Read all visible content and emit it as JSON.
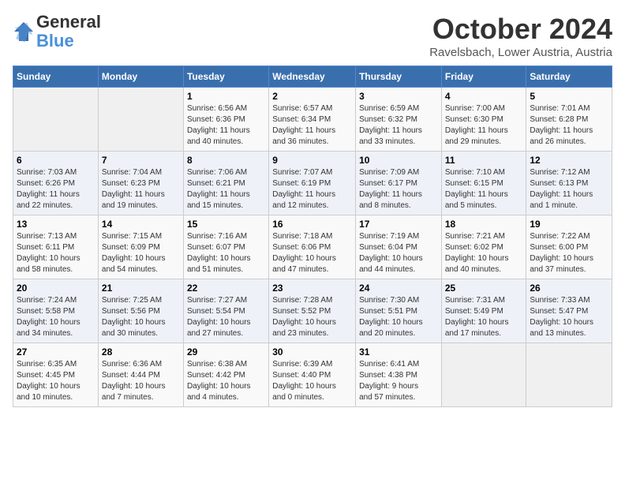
{
  "header": {
    "logo_line1": "General",
    "logo_line2": "Blue",
    "month": "October 2024",
    "location": "Ravelsbach, Lower Austria, Austria"
  },
  "weekdays": [
    "Sunday",
    "Monday",
    "Tuesday",
    "Wednesday",
    "Thursday",
    "Friday",
    "Saturday"
  ],
  "weeks": [
    [
      {
        "day": "",
        "info": ""
      },
      {
        "day": "",
        "info": ""
      },
      {
        "day": "1",
        "info": "Sunrise: 6:56 AM\nSunset: 6:36 PM\nDaylight: 11 hours\nand 40 minutes."
      },
      {
        "day": "2",
        "info": "Sunrise: 6:57 AM\nSunset: 6:34 PM\nDaylight: 11 hours\nand 36 minutes."
      },
      {
        "day": "3",
        "info": "Sunrise: 6:59 AM\nSunset: 6:32 PM\nDaylight: 11 hours\nand 33 minutes."
      },
      {
        "day": "4",
        "info": "Sunrise: 7:00 AM\nSunset: 6:30 PM\nDaylight: 11 hours\nand 29 minutes."
      },
      {
        "day": "5",
        "info": "Sunrise: 7:01 AM\nSunset: 6:28 PM\nDaylight: 11 hours\nand 26 minutes."
      }
    ],
    [
      {
        "day": "6",
        "info": "Sunrise: 7:03 AM\nSunset: 6:26 PM\nDaylight: 11 hours\nand 22 minutes."
      },
      {
        "day": "7",
        "info": "Sunrise: 7:04 AM\nSunset: 6:23 PM\nDaylight: 11 hours\nand 19 minutes."
      },
      {
        "day": "8",
        "info": "Sunrise: 7:06 AM\nSunset: 6:21 PM\nDaylight: 11 hours\nand 15 minutes."
      },
      {
        "day": "9",
        "info": "Sunrise: 7:07 AM\nSunset: 6:19 PM\nDaylight: 11 hours\nand 12 minutes."
      },
      {
        "day": "10",
        "info": "Sunrise: 7:09 AM\nSunset: 6:17 PM\nDaylight: 11 hours\nand 8 minutes."
      },
      {
        "day": "11",
        "info": "Sunrise: 7:10 AM\nSunset: 6:15 PM\nDaylight: 11 hours\nand 5 minutes."
      },
      {
        "day": "12",
        "info": "Sunrise: 7:12 AM\nSunset: 6:13 PM\nDaylight: 11 hours\nand 1 minute."
      }
    ],
    [
      {
        "day": "13",
        "info": "Sunrise: 7:13 AM\nSunset: 6:11 PM\nDaylight: 10 hours\nand 58 minutes."
      },
      {
        "day": "14",
        "info": "Sunrise: 7:15 AM\nSunset: 6:09 PM\nDaylight: 10 hours\nand 54 minutes."
      },
      {
        "day": "15",
        "info": "Sunrise: 7:16 AM\nSunset: 6:07 PM\nDaylight: 10 hours\nand 51 minutes."
      },
      {
        "day": "16",
        "info": "Sunrise: 7:18 AM\nSunset: 6:06 PM\nDaylight: 10 hours\nand 47 minutes."
      },
      {
        "day": "17",
        "info": "Sunrise: 7:19 AM\nSunset: 6:04 PM\nDaylight: 10 hours\nand 44 minutes."
      },
      {
        "day": "18",
        "info": "Sunrise: 7:21 AM\nSunset: 6:02 PM\nDaylight: 10 hours\nand 40 minutes."
      },
      {
        "day": "19",
        "info": "Sunrise: 7:22 AM\nSunset: 6:00 PM\nDaylight: 10 hours\nand 37 minutes."
      }
    ],
    [
      {
        "day": "20",
        "info": "Sunrise: 7:24 AM\nSunset: 5:58 PM\nDaylight: 10 hours\nand 34 minutes."
      },
      {
        "day": "21",
        "info": "Sunrise: 7:25 AM\nSunset: 5:56 PM\nDaylight: 10 hours\nand 30 minutes."
      },
      {
        "day": "22",
        "info": "Sunrise: 7:27 AM\nSunset: 5:54 PM\nDaylight: 10 hours\nand 27 minutes."
      },
      {
        "day": "23",
        "info": "Sunrise: 7:28 AM\nSunset: 5:52 PM\nDaylight: 10 hours\nand 23 minutes."
      },
      {
        "day": "24",
        "info": "Sunrise: 7:30 AM\nSunset: 5:51 PM\nDaylight: 10 hours\nand 20 minutes."
      },
      {
        "day": "25",
        "info": "Sunrise: 7:31 AM\nSunset: 5:49 PM\nDaylight: 10 hours\nand 17 minutes."
      },
      {
        "day": "26",
        "info": "Sunrise: 7:33 AM\nSunset: 5:47 PM\nDaylight: 10 hours\nand 13 minutes."
      }
    ],
    [
      {
        "day": "27",
        "info": "Sunrise: 6:35 AM\nSunset: 4:45 PM\nDaylight: 10 hours\nand 10 minutes."
      },
      {
        "day": "28",
        "info": "Sunrise: 6:36 AM\nSunset: 4:44 PM\nDaylight: 10 hours\nand 7 minutes."
      },
      {
        "day": "29",
        "info": "Sunrise: 6:38 AM\nSunset: 4:42 PM\nDaylight: 10 hours\nand 4 minutes."
      },
      {
        "day": "30",
        "info": "Sunrise: 6:39 AM\nSunset: 4:40 PM\nDaylight: 10 hours\nand 0 minutes."
      },
      {
        "day": "31",
        "info": "Sunrise: 6:41 AM\nSunset: 4:38 PM\nDaylight: 9 hours\nand 57 minutes."
      },
      {
        "day": "",
        "info": ""
      },
      {
        "day": "",
        "info": ""
      }
    ]
  ]
}
